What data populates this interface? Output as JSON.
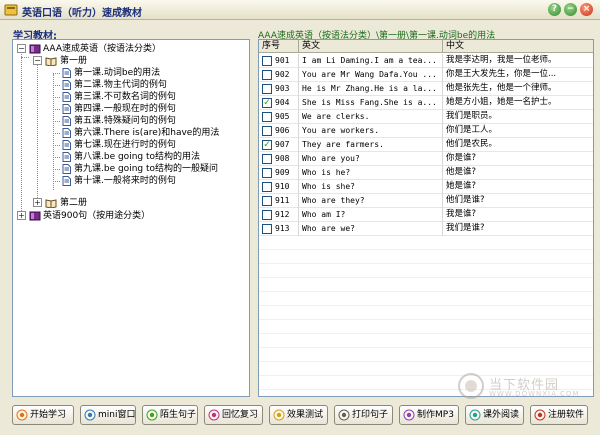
{
  "window": {
    "title": "英语口语（听力）速成教材",
    "controls": [
      "help-icon",
      "minimize-icon",
      "close-icon"
    ]
  },
  "left_pane": {
    "label": "学习教材:",
    "tree": [
      {
        "label": "AAA速成英语（按语法分类）",
        "icon": "book-icon",
        "expanded": true
      },
      {
        "label": "第一册",
        "icon": "book-open-icon",
        "expanded": true
      },
      {
        "label": "第一课.动词be的用法",
        "icon": "document-icon"
      },
      {
        "label": "第二课.物主代词的例句",
        "icon": "document-icon"
      },
      {
        "label": "第三课.不可数名词的例句",
        "icon": "document-icon"
      },
      {
        "label": "第四课.一般现在时的例句",
        "icon": "document-icon"
      },
      {
        "label": "第五课.特殊疑问句的例句",
        "icon": "document-icon"
      },
      {
        "label": "第六课.There is(are)和have的用法",
        "icon": "document-icon"
      },
      {
        "label": "第七课.现在进行时的例句",
        "icon": "document-icon"
      },
      {
        "label": "第八课.be going to结构的用法",
        "icon": "document-icon"
      },
      {
        "label": "第九课.be going to结构的一般疑问",
        "icon": "document-icon"
      },
      {
        "label": "第十课.一般将来时的例句",
        "icon": "document-icon"
      },
      {
        "label": "第二册",
        "icon": "book-open-icon",
        "expanded": false
      },
      {
        "label": "英语900句（按用途分类）",
        "icon": "book-icon",
        "expanded": false
      }
    ]
  },
  "right_pane": {
    "breadcrumb": "AAA速成英语（按语法分类）\\第一册\\第一课.动词be的用法",
    "columns": [
      "序号",
      "英文",
      "中文"
    ],
    "rows": [
      {
        "checked": false,
        "num": "901",
        "en": "I am Li Daming.I am a tea...",
        "zh": "我是李达明，我是一位老师。"
      },
      {
        "checked": false,
        "num": "902",
        "en": "You are Mr Wang Dafa.You ...",
        "zh": "你是王大发先生，你是一位..."
      },
      {
        "checked": false,
        "num": "903",
        "en": "He is Mr Zhang.He is a la...",
        "zh": "他是张先生，他是一个律师。"
      },
      {
        "checked": true,
        "num": "904",
        "en": "She is Miss Fang.She is a...",
        "zh": "她是方小姐，她是一名护士。"
      },
      {
        "checked": false,
        "num": "905",
        "en": "We are clerks.",
        "zh": "我们是职员。"
      },
      {
        "checked": false,
        "num": "906",
        "en": "You are workers.",
        "zh": "你们是工人。"
      },
      {
        "checked": true,
        "num": "907",
        "en": "They are farmers.",
        "zh": "他们是农民。"
      },
      {
        "checked": false,
        "num": "908",
        "en": "Who are you?",
        "zh": "你是谁?"
      },
      {
        "checked": false,
        "num": "909",
        "en": "Who is he?",
        "zh": "他是谁?"
      },
      {
        "checked": false,
        "num": "910",
        "en": "Who is she?",
        "zh": "她是谁?"
      },
      {
        "checked": false,
        "num": "911",
        "en": "Who are they?",
        "zh": "他们是谁?"
      },
      {
        "checked": false,
        "num": "912",
        "en": "Who am I?",
        "zh": "我是谁?"
      },
      {
        "checked": false,
        "num": "913",
        "en": "Who are we?",
        "zh": "我们是谁?"
      }
    ]
  },
  "toolbar": {
    "buttons": [
      {
        "label": "开始学习",
        "icon": "play-icon"
      },
      {
        "label": "mini窗口",
        "icon": "window-icon"
      },
      {
        "label": "陌生句子",
        "icon": "sentence-icon"
      },
      {
        "label": "回忆复习",
        "icon": "review-icon"
      },
      {
        "label": "效果测试",
        "icon": "test-icon"
      },
      {
        "label": "打印句子",
        "icon": "print-icon"
      },
      {
        "label": "制作MP3",
        "icon": "mp3-icon"
      },
      {
        "label": "课外阅读",
        "icon": "reading-icon"
      },
      {
        "label": "注册软件",
        "icon": "register-icon"
      }
    ]
  },
  "watermark": {
    "text": "当下软件园",
    "sub": "WWW.DOWNXIA.COM"
  },
  "colors": {
    "title": "#1a2e7a",
    "breadcrumb": "#1a6a1a",
    "check": "#21a121",
    "bg": "#ece9d8"
  }
}
